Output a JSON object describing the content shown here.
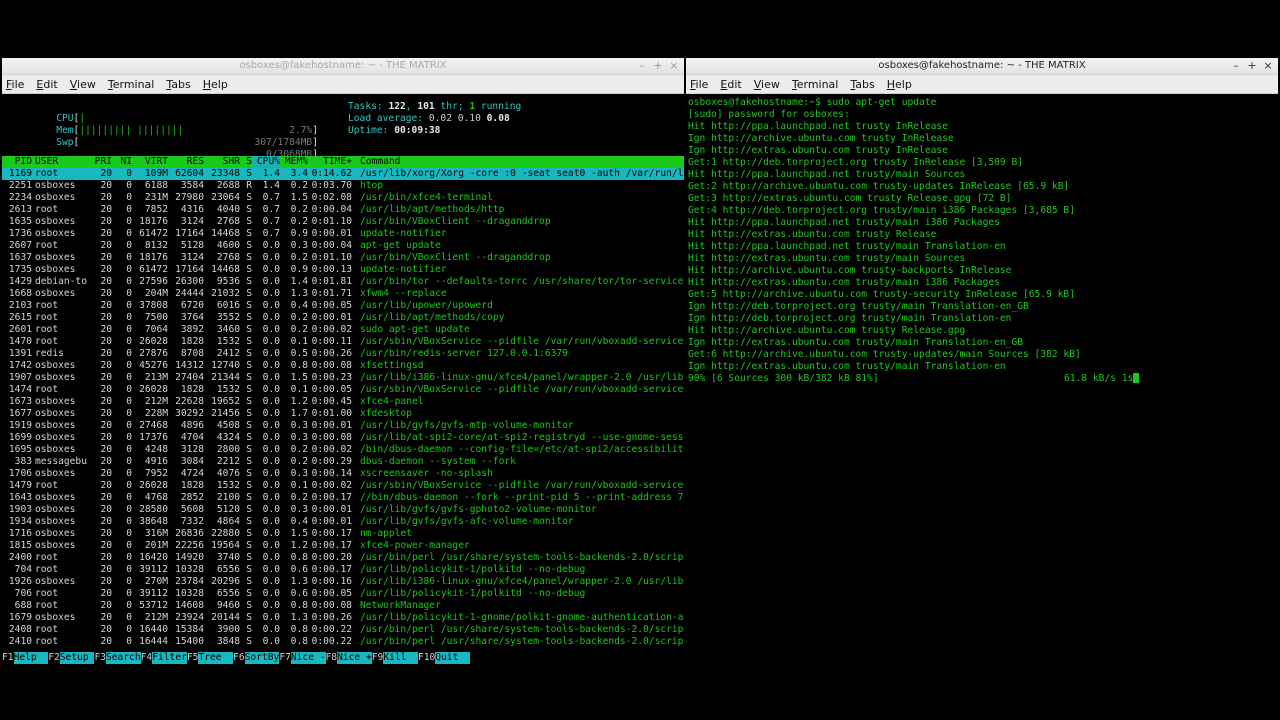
{
  "left_window": {
    "title": "osboxes@fakehostname: ~ - THE MATRIX",
    "menu": [
      "File",
      "Edit",
      "View",
      "Terminal",
      "Tabs",
      "Help"
    ],
    "meters": {
      "cpu": {
        "label": "CPU",
        "bar": "|",
        "value": "2.7%"
      },
      "mem": {
        "label": "Mem",
        "bar": "||||||||| ||||||||",
        "value": "307/1784MB"
      },
      "swp": {
        "label": "Swp",
        "bar": "",
        "value": "0/3068MB"
      }
    },
    "stats": {
      "tasks_label": "Tasks: ",
      "tasks": "122",
      "thr_sep": ", ",
      "thr": "101",
      "thr_label": " thr; ",
      "running": "1",
      "running_label": " running",
      "load_label": "Load average: ",
      "load1": "0.02",
      "load5": "0.10",
      "load15": "0.08",
      "uptime_label": "Uptime: ",
      "uptime": "00:09:38"
    },
    "columns": [
      "PID",
      "USER",
      "PRI",
      "NI",
      "VIRT",
      "RES",
      "SHR",
      "S",
      "CPU%",
      "MEM%",
      "TIME+",
      "Command"
    ],
    "processes": [
      [
        "1169",
        "root",
        "20",
        "0",
        "109M",
        "62604",
        "23348",
        "S",
        "1.4",
        "3.4",
        "0:14.62",
        "/usr/lib/xorg/Xorg -core :0 -seat seat0 -auth /var/run/li"
      ],
      [
        "2251",
        "osboxes",
        "20",
        "0",
        "6188",
        "3584",
        "2688",
        "R",
        "1.4",
        "0.2",
        "0:03.70",
        "htop"
      ],
      [
        "2234",
        "osboxes",
        "20",
        "0",
        "231M",
        "27980",
        "23064",
        "S",
        "0.7",
        "1.5",
        "0:02.08",
        "/usr/bin/xfce4-terminal"
      ],
      [
        "2613",
        "root",
        "20",
        "0",
        "7852",
        "4316",
        "4040",
        "S",
        "0.7",
        "0.2",
        "0:00.04",
        "/usr/lib/apt/methods/http"
      ],
      [
        "1635",
        "osboxes",
        "20",
        "0",
        "18176",
        "3124",
        "2768",
        "S",
        "0.7",
        "0.2",
        "0:01.10",
        "/usr/bin/VBoxClient --draganddrop"
      ],
      [
        "1736",
        "osboxes",
        "20",
        "0",
        "61472",
        "17164",
        "14468",
        "S",
        "0.7",
        "0.9",
        "0:00.01",
        "update-notifier"
      ],
      [
        "2607",
        "root",
        "20",
        "0",
        "8132",
        "5128",
        "4600",
        "S",
        "0.0",
        "0.3",
        "0:00.04",
        "apt-get update"
      ],
      [
        "1637",
        "osboxes",
        "20",
        "0",
        "18176",
        "3124",
        "2768",
        "S",
        "0.0",
        "0.2",
        "0:01.10",
        "/usr/bin/VBoxClient --draganddrop"
      ],
      [
        "1735",
        "osboxes",
        "20",
        "0",
        "61472",
        "17164",
        "14468",
        "S",
        "0.0",
        "0.9",
        "0:00.13",
        "update-notifier"
      ],
      [
        "1429",
        "debian-to",
        "20",
        "0",
        "27596",
        "26300",
        "9536",
        "S",
        "0.0",
        "1.4",
        "0:01.81",
        "/usr/bin/tor --defaults-torrc /usr/share/tor/tor-service-"
      ],
      [
        "1668",
        "osboxes",
        "20",
        "0",
        "204M",
        "24444",
        "21032",
        "S",
        "0.0",
        "1.3",
        "0:01.71",
        "xfwm4 --replace"
      ],
      [
        "2103",
        "root",
        "20",
        "0",
        "37808",
        "6720",
        "6016",
        "S",
        "0.0",
        "0.4",
        "0:00.05",
        "/usr/lib/upower/upowerd"
      ],
      [
        "2615",
        "root",
        "20",
        "0",
        "7500",
        "3764",
        "3552",
        "S",
        "0.0",
        "0.2",
        "0:00.01",
        "/usr/lib/apt/methods/copy"
      ],
      [
        "2601",
        "root",
        "20",
        "0",
        "7064",
        "3892",
        "3460",
        "S",
        "0.0",
        "0.2",
        "0:00.02",
        "sudo apt-get update"
      ],
      [
        "1470",
        "root",
        "20",
        "0",
        "26028",
        "1828",
        "1532",
        "S",
        "0.0",
        "0.1",
        "0:00.11",
        "/usr/sbin/VBoxService --pidfile /var/run/vboxadd-service."
      ],
      [
        "1391",
        "redis",
        "20",
        "0",
        "27876",
        "8708",
        "2412",
        "S",
        "0.0",
        "0.5",
        "0:00.26",
        "/usr/bin/redis-server 127.0.0.1:6379"
      ],
      [
        "1742",
        "osboxes",
        "20",
        "0",
        "45276",
        "14312",
        "12740",
        "S",
        "0.0",
        "0.8",
        "0:00.08",
        "xfsettingsd"
      ],
      [
        "1907",
        "osboxes",
        "20",
        "0",
        "213M",
        "27404",
        "21344",
        "S",
        "0.0",
        "1.5",
        "0:00.23",
        "/usr/lib/i386-linux-gnu/xfce4/panel/wrapper-2.0 /usr/lib/"
      ],
      [
        "1474",
        "root",
        "20",
        "0",
        "26028",
        "1828",
        "1532",
        "S",
        "0.0",
        "0.1",
        "0:00.05",
        "/usr/sbin/VBoxService --pidfile /var/run/vboxadd-service."
      ],
      [
        "1673",
        "osboxes",
        "20",
        "0",
        "212M",
        "22628",
        "19652",
        "S",
        "0.0",
        "1.2",
        "0:00.45",
        "xfce4-panel"
      ],
      [
        "1677",
        "osboxes",
        "20",
        "0",
        "228M",
        "30292",
        "21456",
        "S",
        "0.0",
        "1.7",
        "0:01.00",
        "xfdesktop"
      ],
      [
        "1919",
        "osboxes",
        "20",
        "0",
        "27468",
        "4896",
        "4508",
        "S",
        "0.0",
        "0.3",
        "0:00.01",
        "/usr/lib/gvfs/gvfs-mtp-volume-monitor"
      ],
      [
        "1699",
        "osboxes",
        "20",
        "0",
        "17376",
        "4704",
        "4324",
        "S",
        "0.0",
        "0.3",
        "0:00.08",
        "/usr/lib/at-spi2-core/at-spi2-registryd --use-gnome-sessi"
      ],
      [
        "1695",
        "osboxes",
        "20",
        "0",
        "4248",
        "3128",
        "2800",
        "S",
        "0.0",
        "0.2",
        "0:00.02",
        "/bin/dbus-daemon --config-file=/etc/at-spi2/accessibility"
      ],
      [
        "383",
        "messagebu",
        "20",
        "0",
        "4916",
        "3084",
        "2212",
        "S",
        "0.0",
        "0.2",
        "0:00.29",
        "dbus-daemon --system --fork"
      ],
      [
        "1706",
        "osboxes",
        "20",
        "0",
        "7952",
        "4724",
        "4076",
        "S",
        "0.0",
        "0.3",
        "0:00.14",
        "xscreensaver -no-splash"
      ],
      [
        "1479",
        "root",
        "20",
        "0",
        "26028",
        "1828",
        "1532",
        "S",
        "0.0",
        "0.1",
        "0:00.02",
        "/usr/sbin/VBoxService --pidfile /var/run/vboxadd-service."
      ],
      [
        "1643",
        "osboxes",
        "20",
        "0",
        "4768",
        "2852",
        "2100",
        "S",
        "0.0",
        "0.2",
        "0:00.17",
        "//bin/dbus-daemon --fork --print-pid 5 --print-address 7"
      ],
      [
        "1903",
        "osboxes",
        "20",
        "0",
        "28580",
        "5608",
        "5120",
        "S",
        "0.0",
        "0.3",
        "0:00.01",
        "/usr/lib/gvfs/gvfs-gphoto2-volume-monitor"
      ],
      [
        "1934",
        "osboxes",
        "20",
        "0",
        "38648",
        "7332",
        "4864",
        "S",
        "0.0",
        "0.4",
        "0:00.01",
        "/usr/lib/gvfs/gvfs-afc-volume-monitor"
      ],
      [
        "1716",
        "osboxes",
        "20",
        "0",
        "316M",
        "26836",
        "22880",
        "S",
        "0.0",
        "1.5",
        "0:00.17",
        "nm-applet"
      ],
      [
        "1815",
        "osboxes",
        "20",
        "0",
        "201M",
        "22256",
        "19564",
        "S",
        "0.0",
        "1.2",
        "0:00.17",
        "xfce4-power-manager"
      ],
      [
        "2400",
        "root",
        "20",
        "0",
        "16420",
        "14920",
        "3740",
        "S",
        "0.0",
        "0.8",
        "0:00.20",
        "/usr/bin/perl /usr/share/system-tools-backends-2.0/script"
      ],
      [
        "704",
        "root",
        "20",
        "0",
        "39112",
        "10328",
        "6556",
        "S",
        "0.0",
        "0.6",
        "0:00.17",
        "/usr/lib/policykit-1/polkitd --no-debug"
      ],
      [
        "1926",
        "osboxes",
        "20",
        "0",
        "270M",
        "23784",
        "20296",
        "S",
        "0.0",
        "1.3",
        "0:00.16",
        "/usr/lib/i386-linux-gnu/xfce4/panel/wrapper-2.0 /usr/lib/"
      ],
      [
        "706",
        "root",
        "20",
        "0",
        "39112",
        "10328",
        "6556",
        "S",
        "0.0",
        "0.6",
        "0:00.05",
        "/usr/lib/policykit-1/polkitd --no-debug"
      ],
      [
        "688",
        "root",
        "20",
        "0",
        "53712",
        "14608",
        "9460",
        "S",
        "0.0",
        "0.8",
        "0:00.08",
        "NetworkManager"
      ],
      [
        "1679",
        "osboxes",
        "20",
        "0",
        "212M",
        "23924",
        "20144",
        "S",
        "0.0",
        "1.3",
        "0:00.26",
        "/usr/lib/policykit-1-gnome/polkit-gnome-authentication-ag"
      ],
      [
        "2408",
        "root",
        "20",
        "0",
        "16440",
        "15384",
        "3900",
        "S",
        "0.0",
        "0.8",
        "0:00.22",
        "/usr/bin/perl /usr/share/system-tools-backends-2.0/script"
      ],
      [
        "2410",
        "root",
        "20",
        "0",
        "16444",
        "15400",
        "3848",
        "S",
        "0.0",
        "0.8",
        "0:00.22",
        "/usr/bin/perl /usr/share/system-tools-backends-2.0/script"
      ]
    ],
    "fkeys": [
      {
        "key": "F1",
        "label": "Help  "
      },
      {
        "key": "F2",
        "label": "Setup "
      },
      {
        "key": "F3",
        "label": "Search"
      },
      {
        "key": "F4",
        "label": "Filter"
      },
      {
        "key": "F5",
        "label": "Tree  "
      },
      {
        "key": "F6",
        "label": "SortBy"
      },
      {
        "key": "F7",
        "label": "Nice -"
      },
      {
        "key": "F8",
        "label": "Nice +"
      },
      {
        "key": "F9",
        "label": "Kill  "
      },
      {
        "key": "F10",
        "label": "Quit  "
      }
    ]
  },
  "right_window": {
    "title": "osboxes@fakehostname: ~ - THE MATRIX",
    "menu": [
      "File",
      "Edit",
      "View",
      "Terminal",
      "Tabs",
      "Help"
    ],
    "lines": [
      "osboxes@fakehostname:~$ sudo apt-get update",
      "[sudo] password for osboxes:",
      "Hit http://ppa.launchpad.net trusty InRelease",
      "Ign http://archive.ubuntu.com trusty InRelease",
      "Ign http://extras.ubuntu.com trusty InRelease",
      "Get:1 http://deb.torproject.org trusty InRelease [3,509 B]",
      "Hit http://ppa.launchpad.net trusty/main Sources",
      "Get:2 http://archive.ubuntu.com trusty-updates InRelease [65.9 kB]",
      "Get:3 http://extras.ubuntu.com trusty Release.gpg [72 B]",
      "Get:4 http://deb.torproject.org trusty/main i386 Packages [3,685 B]",
      "Hit http://ppa.launchpad.net trusty/main i386 Packages",
      "Hit http://extras.ubuntu.com trusty Release",
      "Hit http://ppa.launchpad.net trusty/main Translation-en",
      "Hit http://extras.ubuntu.com trusty/main Sources",
      "Hit http://archive.ubuntu.com trusty-backports InRelease",
      "Hit http://extras.ubuntu.com trusty/main i386 Packages",
      "Get:5 http://archive.ubuntu.com trusty-security InRelease [65.9 kB]",
      "Ign http://deb.torproject.org trusty/main Translation-en_GB",
      "Ign http://deb.torproject.org trusty/main Translation-en",
      "Hit http://archive.ubuntu.com trusty Release.gpg",
      "Ign http://extras.ubuntu.com trusty/main Translation-en_GB",
      "Get:6 http://archive.ubuntu.com trusty-updates/main Sources [382 kB]",
      "Ign http://extras.ubuntu.com trusty/main Translation-en"
    ],
    "progress_left": "90% [6 Sources 300 kB/382 kB 81%]",
    "progress_right": "61.8 kB/s 1s"
  },
  "window_controls": {
    "minimize": "–",
    "maximize": "+",
    "close": "×"
  }
}
